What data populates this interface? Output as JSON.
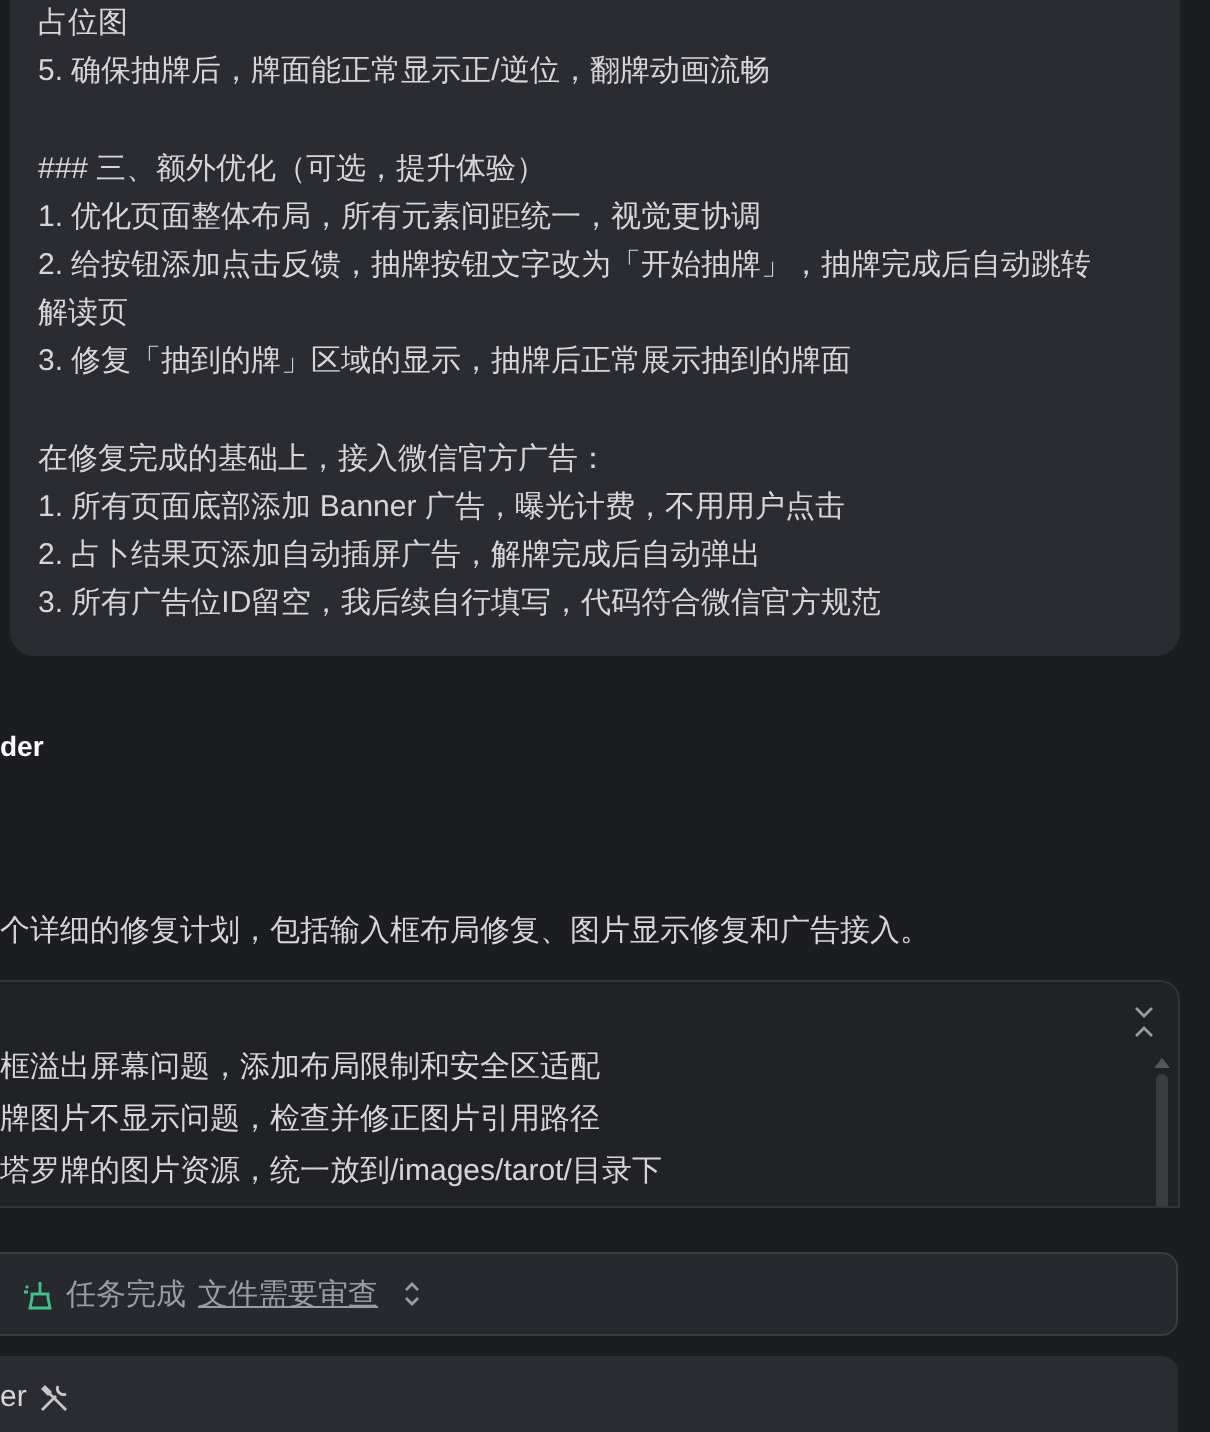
{
  "message": {
    "blocks": [
      [
        "占位图",
        "5.  确保抽牌后，牌面能正常显示正/逆位，翻牌动画流畅"
      ],
      [
        "### 三、额外优化（可选，提升体验）",
        "1.  优化页面整体布局，所有元素间距统一，视觉更协调",
        "2.  给按钮添加点击反馈，抽牌按钮文字改为「开始抽牌」，抽牌完成后自动跳转解读页",
        "3.  修复「抽到的牌」区域的显示，抽牌后正常展示抽到的牌面"
      ],
      [
        "在修复完成的基础上，接入微信官方广告：",
        "1.  所有页面底部添加 Banner 广告，曝光计费，不用用户点击",
        "2.  占卜结果页添加自动插屏广告，解牌完成后自动弹出",
        "3.  所有广告位ID留空，我后续自行填写，代码符合微信官方规范"
      ]
    ]
  },
  "author_label": "der",
  "reply": "个详细的修复计划，包括输入框布局修复、图片显示修复和广告接入。",
  "plan_panel": {
    "items": [
      "框溢出屏幕问题，添加布局限制和安全区适配",
      "牌图片不显示问题，检查并修正图片引用路径",
      "塔罗牌的图片资源，统一放到/images/tarot/目录下"
    ]
  },
  "status_bar": {
    "status": "任务完成",
    "link": "文件需要审查"
  },
  "next_message": {
    "author_label": "er"
  }
}
